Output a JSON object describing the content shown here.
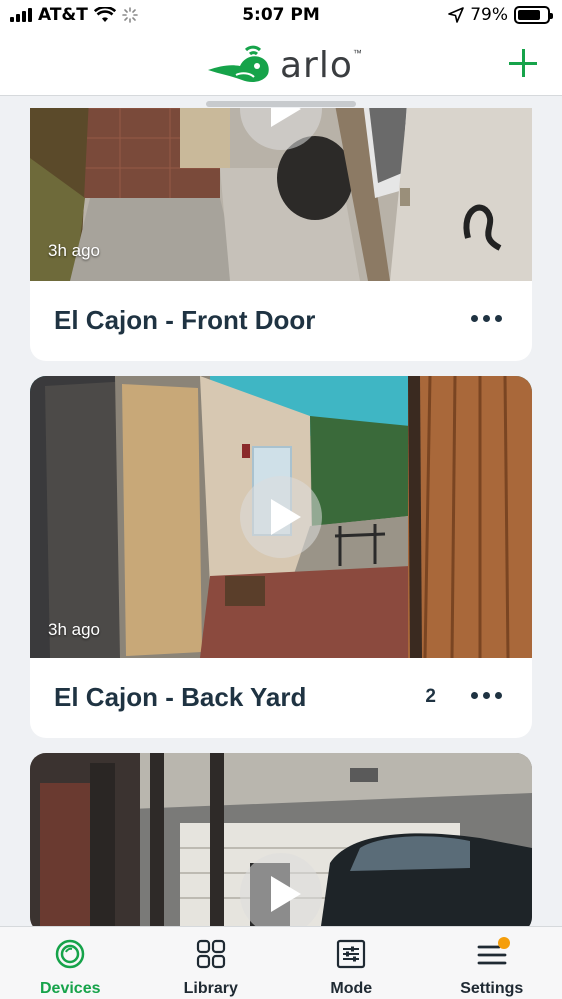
{
  "status_bar": {
    "carrier": "AT&T",
    "time": "5:07 PM",
    "battery": "79%",
    "battery_level": 0.79
  },
  "header": {
    "logo_text": "arlo",
    "logo_tm": "™",
    "accent_color": "#16a34a"
  },
  "cards": [
    {
      "title": "El Cajon - Front Door",
      "time_ago": "3h ago",
      "count": ""
    },
    {
      "title": "El Cajon - Back Yard",
      "time_ago": "3h ago",
      "count": "2"
    },
    {
      "title": "",
      "time_ago": "",
      "count": ""
    }
  ],
  "tabs": [
    {
      "label": "Devices",
      "icon": "devices-icon",
      "active": true
    },
    {
      "label": "Library",
      "icon": "library-grid-icon",
      "active": false
    },
    {
      "label": "Mode",
      "icon": "mode-sliders-icon",
      "active": false
    },
    {
      "label": "Settings",
      "icon": "settings-menu-icon",
      "active": false,
      "notification": true
    }
  ]
}
